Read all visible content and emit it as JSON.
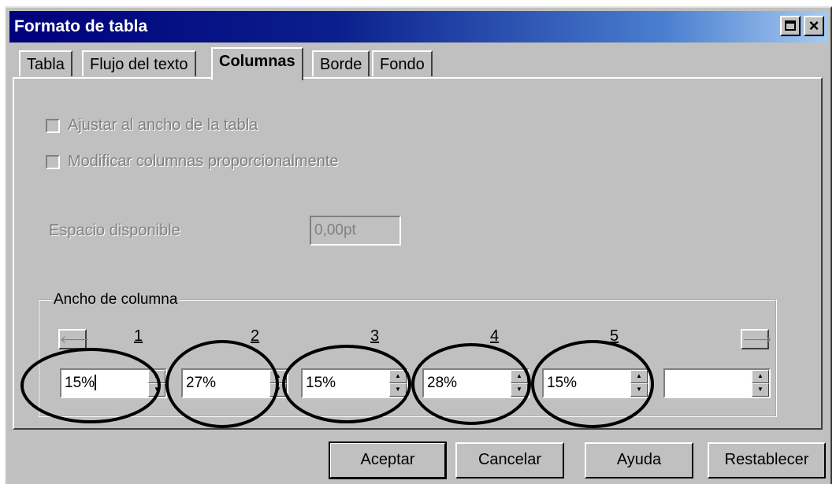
{
  "window": {
    "title": "Formato de tabla"
  },
  "tabs": [
    {
      "label": "Tabla",
      "active": false
    },
    {
      "label": "Flujo del texto",
      "active": false
    },
    {
      "label": "Columnas",
      "active": true
    },
    {
      "label": "Borde",
      "active": false
    },
    {
      "label": "Fondo",
      "active": false
    }
  ],
  "options": {
    "fit_table_width": {
      "label": "Ajustar al ancho de la tabla",
      "checked": false,
      "enabled": false
    },
    "adjust_proportional": {
      "label": "Modificar columnas proporcionalmente",
      "checked": false,
      "enabled": false
    }
  },
  "available_space": {
    "label": "Espacio disponible",
    "value": "0,00pt",
    "enabled": false
  },
  "column_width": {
    "group_title": "Ancho de columna",
    "column_numbers": [
      "1",
      "2",
      "3",
      "4",
      "5"
    ],
    "values": [
      "15%",
      "27%",
      "15%",
      "28%",
      "15%",
      ""
    ],
    "left_arrow_glyph": "🡐",
    "right_arrow_glyph": "🡒"
  },
  "buttons": {
    "ok": "Aceptar",
    "cancel": "Cancelar",
    "help": "Ayuda",
    "reset": "Restablecer"
  },
  "colors": {
    "title_bar_start": "#00007b",
    "title_bar_end": "#a6caf0",
    "dialog_face": "#c0c0c0",
    "annotation_ink": "#000000"
  }
}
